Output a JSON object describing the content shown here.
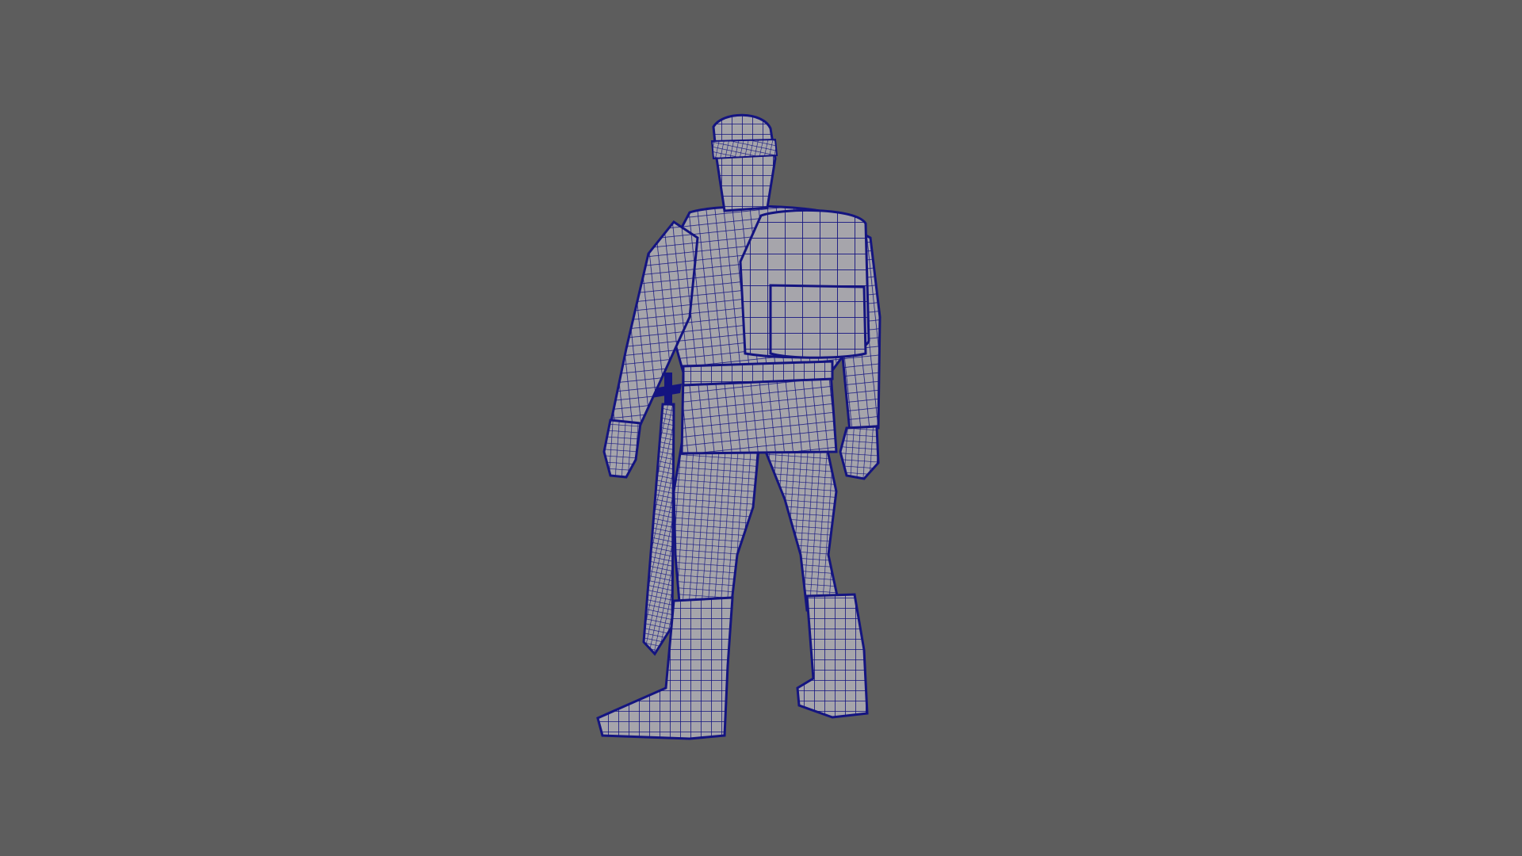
{
  "viewport": {
    "background_color": "#5d5d5d",
    "display_mode": "wireframe-on-shaded"
  },
  "model": {
    "subject": "character",
    "view": "back-three-quarter",
    "shaded_color": "#a6a5ab",
    "wire_color": "#141480",
    "parts": [
      "helmet",
      "torso",
      "backpack",
      "backpack-pocket",
      "belt",
      "left-arm",
      "right-arm",
      "left-leg",
      "right-leg",
      "left-boot",
      "right-boot",
      "sword"
    ]
  }
}
